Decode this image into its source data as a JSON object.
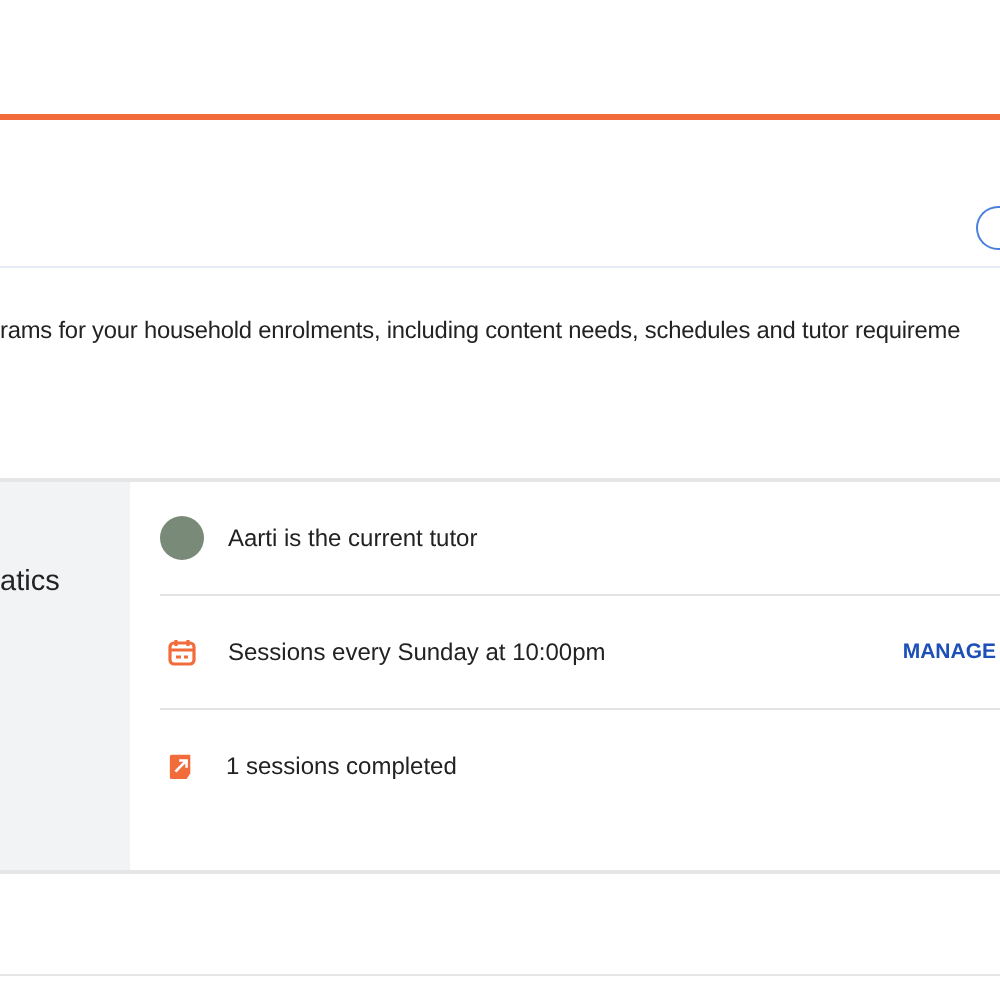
{
  "description": "rams for your household enrolments, including content needs, schedules and tutor requireme",
  "enrolment": {
    "subject": "atics",
    "rows": [
      {
        "kind": "tutor",
        "text": "Aarti is the current tutor"
      },
      {
        "kind": "schedule",
        "text": "Sessions every Sunday at 10:00pm",
        "action": "MANAGE"
      },
      {
        "kind": "progress",
        "text": "1 sessions completed"
      }
    ]
  }
}
